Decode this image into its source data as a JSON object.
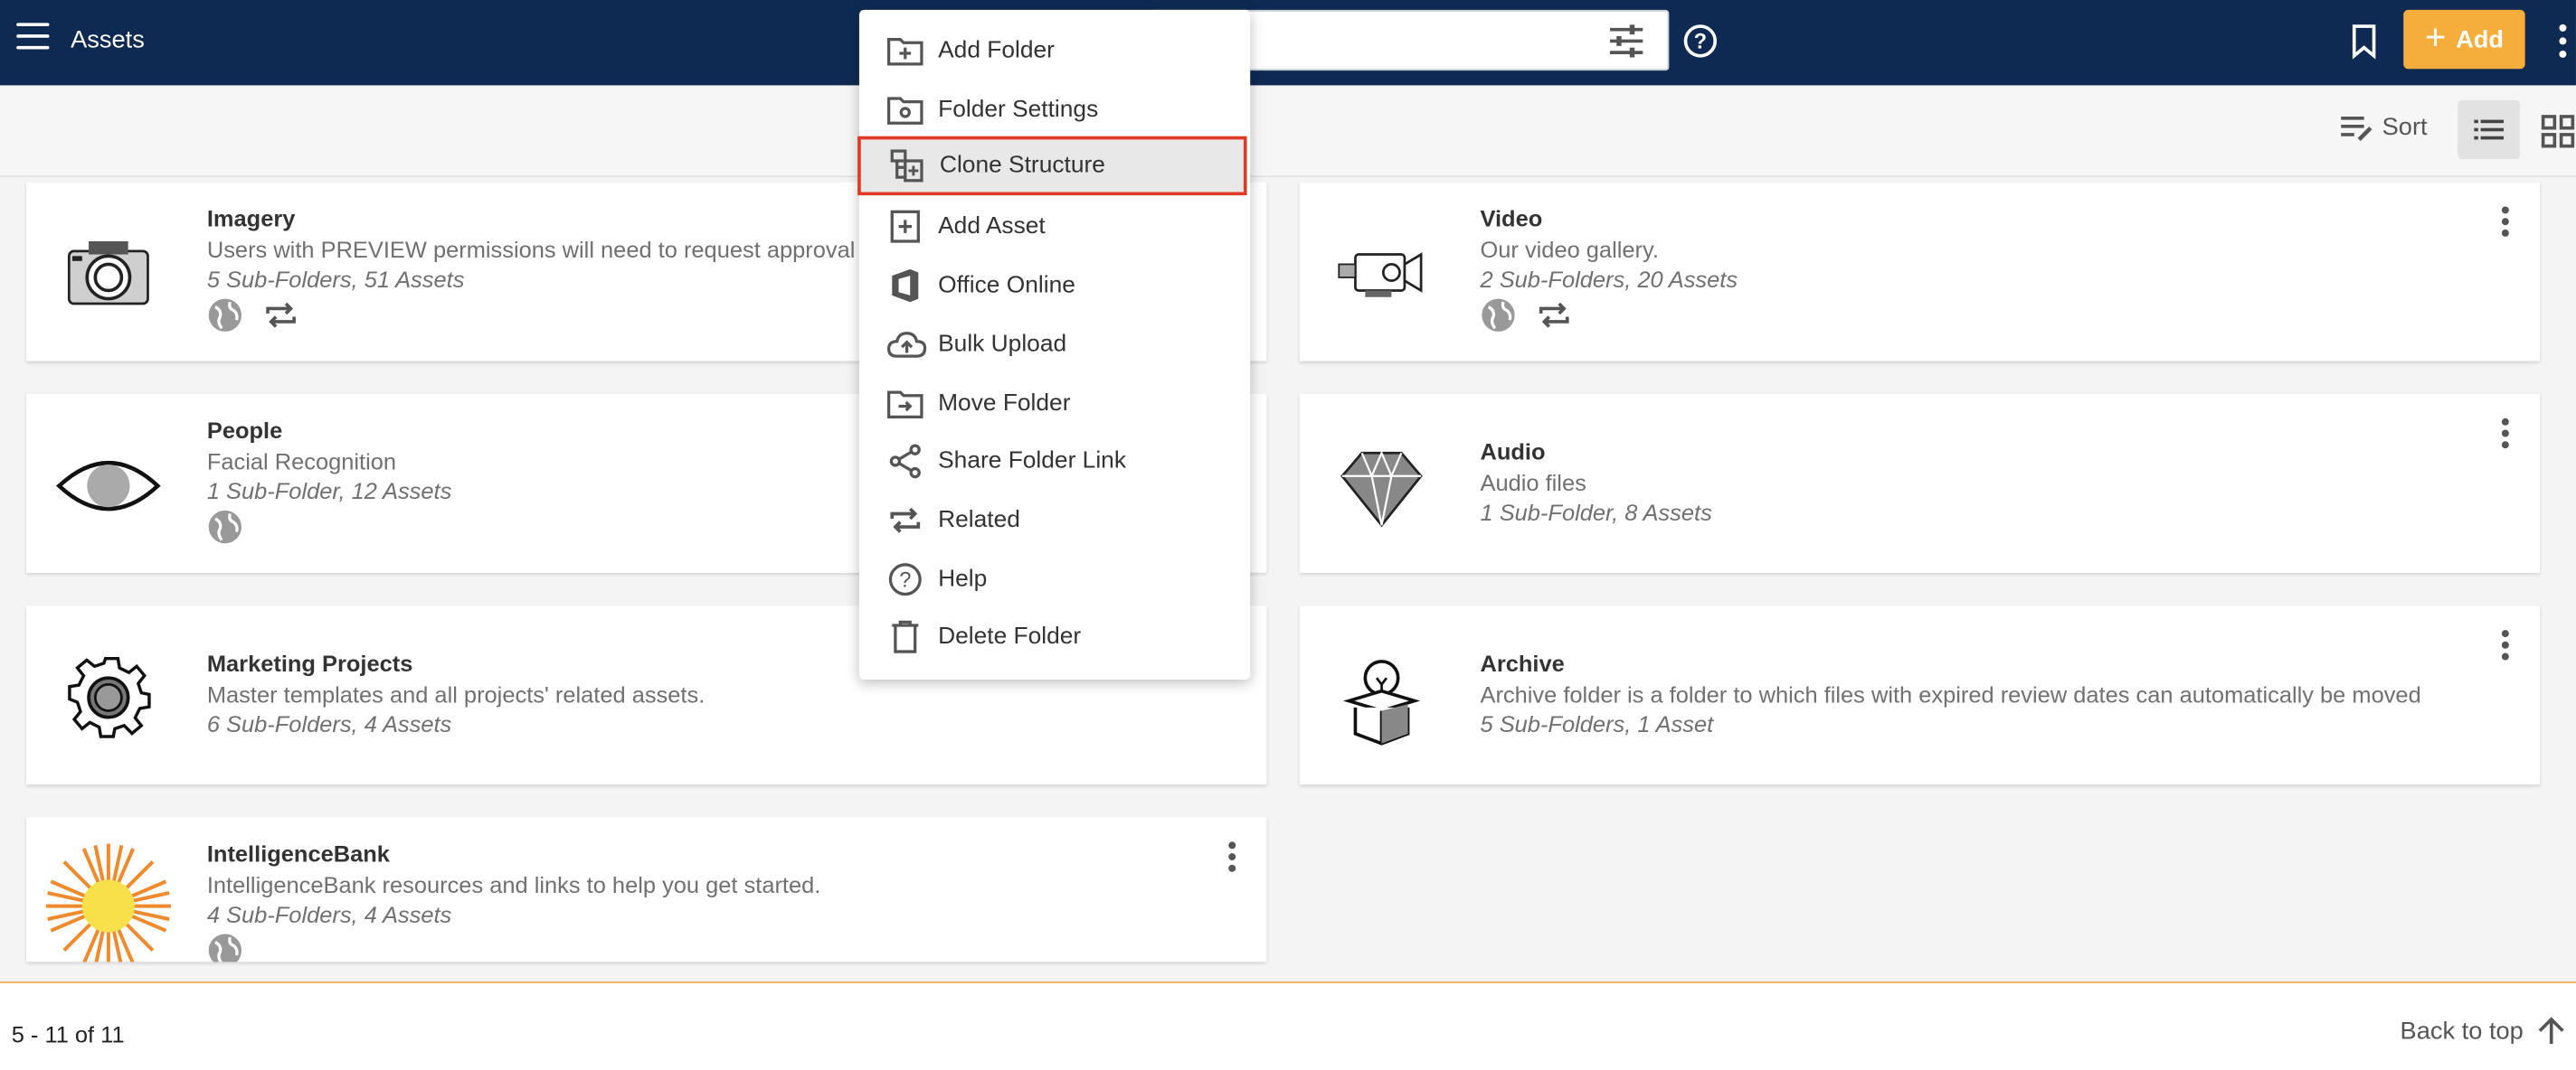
{
  "app": {
    "title": "Assets"
  },
  "header": {
    "add_label": "Add"
  },
  "toolbar": {
    "sort_label": "Sort"
  },
  "folders": [
    {
      "name": "Imagery",
      "description": "Users with PREVIEW permissions will need to request approval a",
      "counts": "5 Sub-Folders, 51 Assets",
      "thumb_icon": "camera-icon"
    },
    {
      "name": "Video",
      "description": "Our video gallery.",
      "counts": "2 Sub-Folders, 20 Assets",
      "thumb_icon": "video-camera-icon"
    },
    {
      "name": "People",
      "description": "Facial Recognition",
      "counts": "1 Sub-Folder, 12 Assets",
      "thumb_icon": "eye-icon"
    },
    {
      "name": "Audio",
      "description": "Audio files",
      "counts": "1 Sub-Folder, 8 Assets",
      "thumb_icon": "diamond-icon"
    },
    {
      "name": "Marketing Projects",
      "description": "Master templates and all projects' related assets.",
      "counts": "6 Sub-Folders, 4 Assets",
      "thumb_icon": "gear-icon"
    },
    {
      "name": "Archive",
      "description": "Archive folder is a folder to which files with expired review dates can automatically be moved",
      "counts": "5 Sub-Folders, 1 Asset",
      "thumb_icon": "lightbulb-box-icon"
    },
    {
      "name": "IntelligenceBank",
      "description": "IntelligenceBank resources and links to help you get started.",
      "counts": "4 Sub-Folders, 4 Assets",
      "thumb_icon": "sun-icon"
    }
  ],
  "menu": {
    "items": [
      {
        "label": "Add Folder",
        "icon": "folder-plus-icon"
      },
      {
        "label": "Folder Settings",
        "icon": "folder-gear-icon"
      },
      {
        "label": "Clone Structure",
        "icon": "clone-structure-icon",
        "highlighted": true
      },
      {
        "label": "Add Asset",
        "icon": "plus-box-icon"
      },
      {
        "label": "Office Online",
        "icon": "office-icon"
      },
      {
        "label": "Bulk Upload",
        "icon": "cloud-upload-icon"
      },
      {
        "label": "Move Folder",
        "icon": "folder-move-icon"
      },
      {
        "label": "Share Folder Link",
        "icon": "share-icon"
      },
      {
        "label": "Related",
        "icon": "repeat-icon"
      },
      {
        "label": "Help",
        "icon": "help-icon"
      },
      {
        "label": "Delete Folder",
        "icon": "trash-icon"
      }
    ]
  },
  "footer": {
    "paging": "5 - 11 of 11",
    "back_to_top": "Back to top"
  },
  "colors": {
    "header_bg": "#0e2a52",
    "accent": "#f5ad3c",
    "highlight_border": "#e03a24"
  }
}
